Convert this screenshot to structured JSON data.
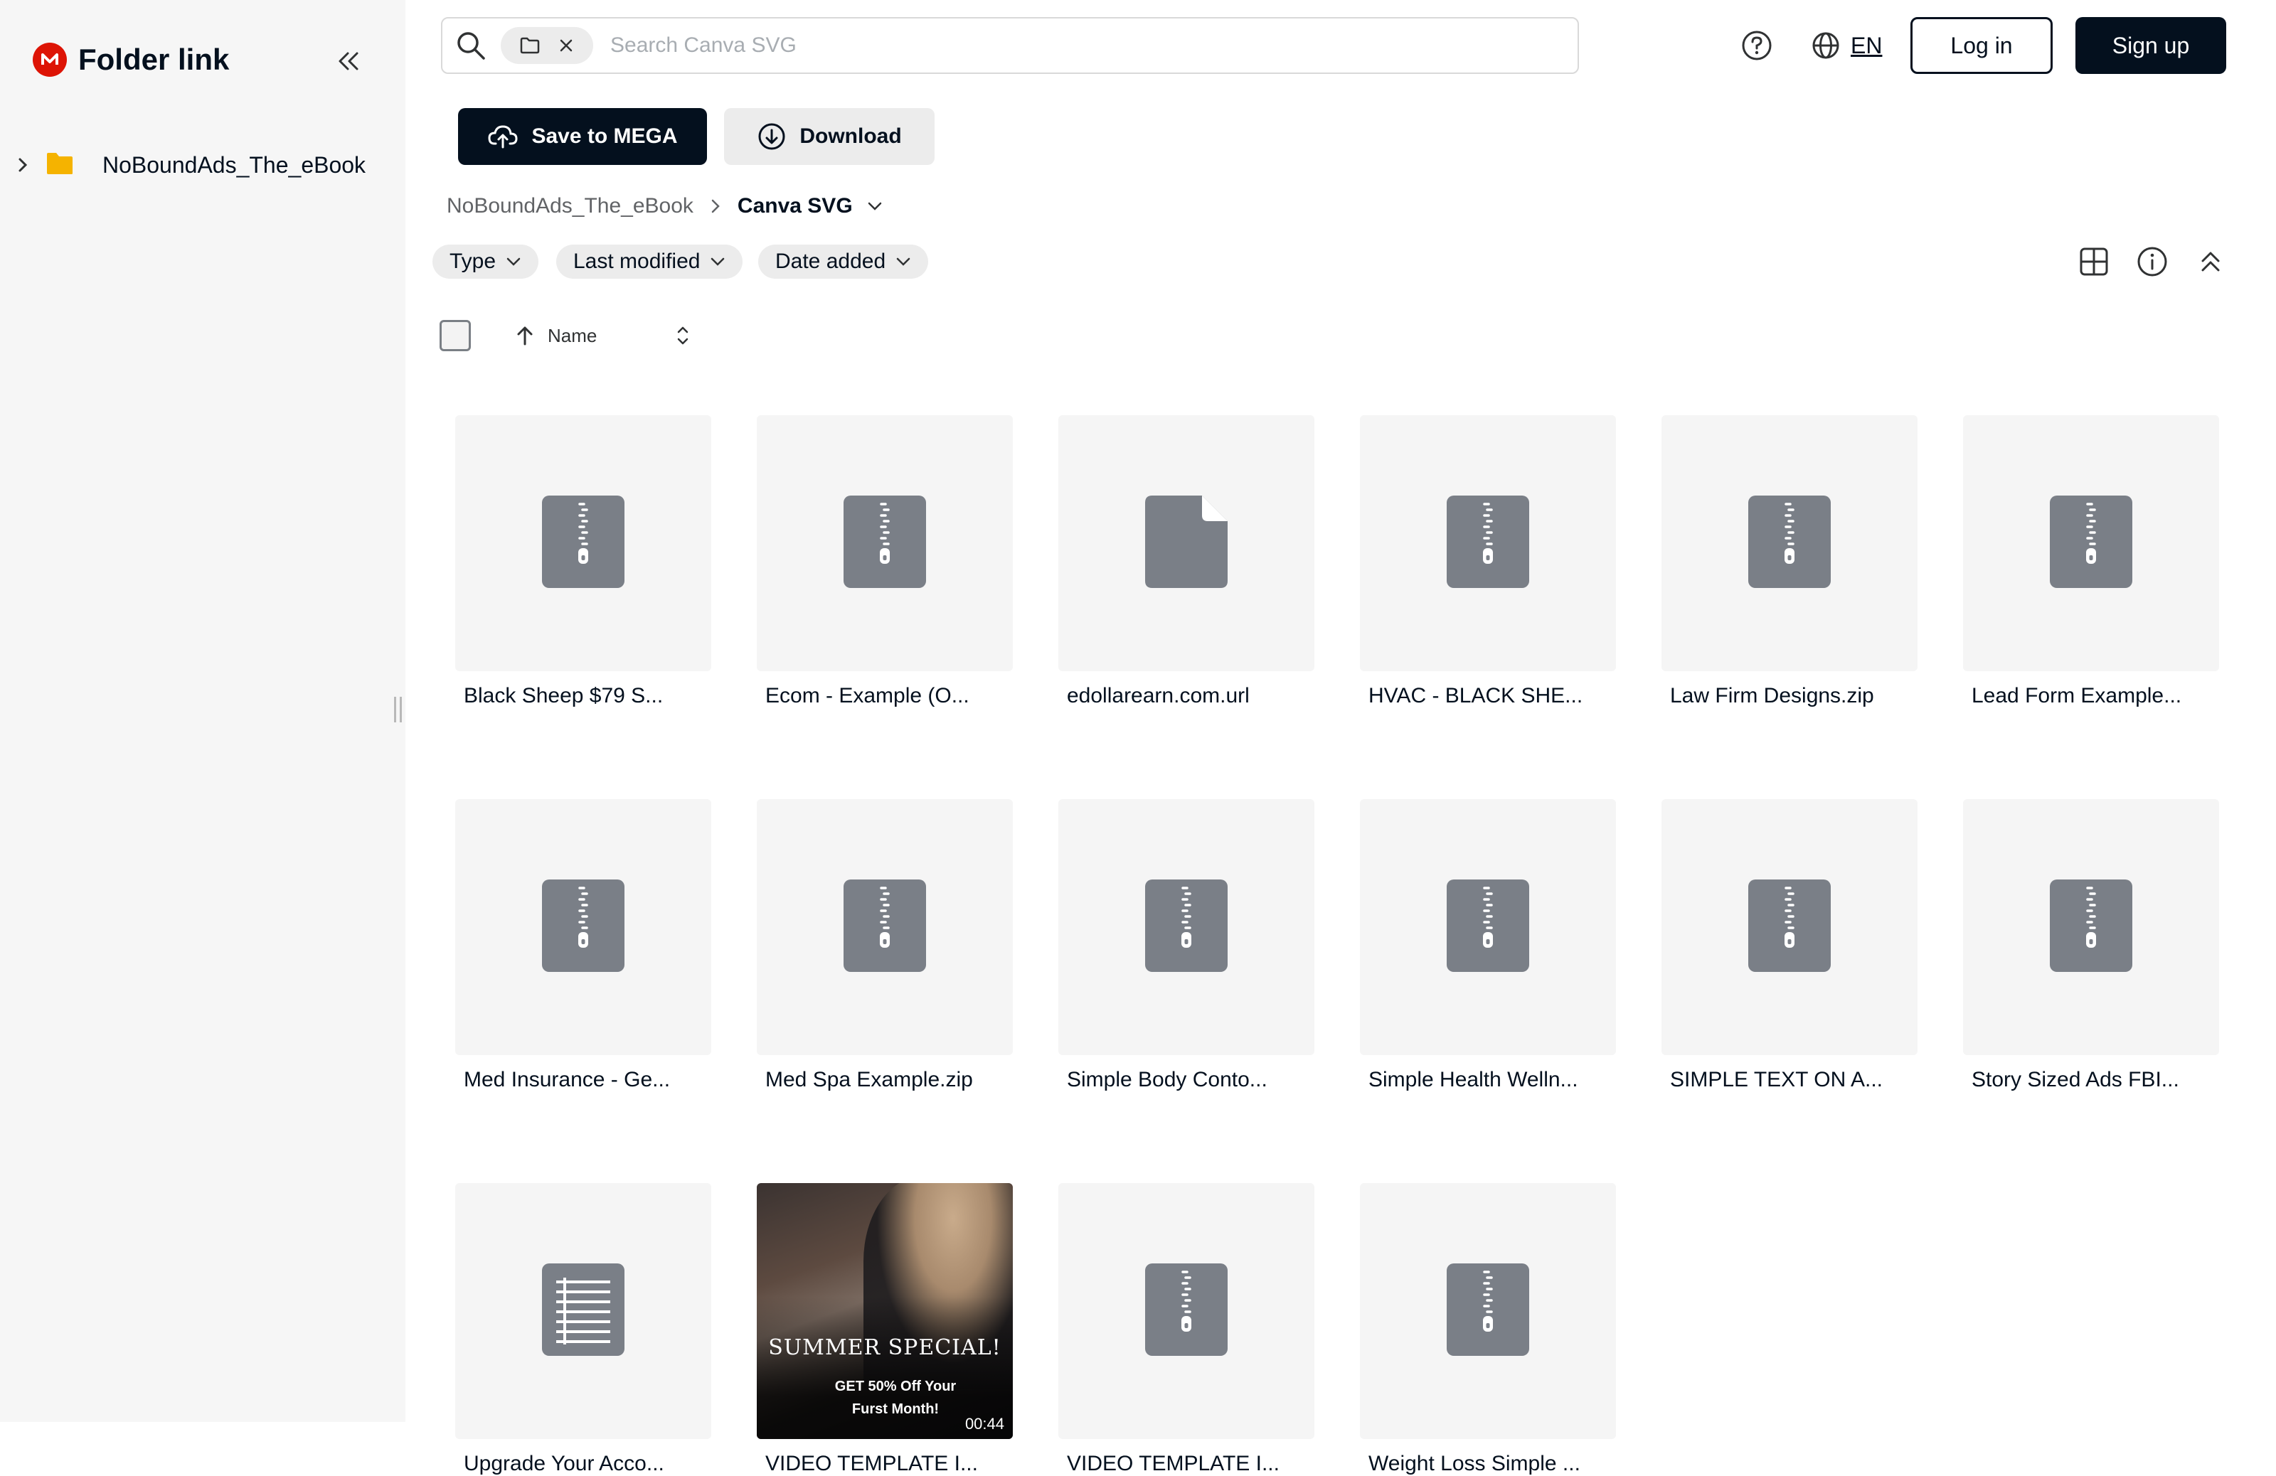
{
  "sidebar": {
    "app_title": "Folder link",
    "tree": [
      {
        "label": "NoBoundAds_The_eBook"
      }
    ]
  },
  "topbar": {
    "search_chip_icon": "folder-icon",
    "search_placeholder": "Search Canva SVG",
    "language": "EN",
    "login_label": "Log in",
    "signup_label": "Sign up"
  },
  "actions": {
    "save_label": "Save to MEGA",
    "download_label": "Download"
  },
  "breadcrumb": {
    "root": "NoBoundAds_The_eBook",
    "current": "Canva SVG"
  },
  "filters": {
    "type": "Type",
    "last_modified": "Last modified",
    "date_added": "Date added"
  },
  "sort": {
    "label": "Name",
    "direction": "ascending"
  },
  "files": [
    {
      "name": "Black Sheep $79 S...",
      "kind": "zip"
    },
    {
      "name": "Ecom - Example (O...",
      "kind": "zip"
    },
    {
      "name": "edollarearn.com.url",
      "kind": "generic"
    },
    {
      "name": "HVAC - BLACK SHE...",
      "kind": "zip"
    },
    {
      "name": "Law Firm Designs.zip",
      "kind": "zip"
    },
    {
      "name": "Lead Form Example...",
      "kind": "zip"
    },
    {
      "name": "Med Insurance - Ge...",
      "kind": "zip"
    },
    {
      "name": "Med Spa Example.zip",
      "kind": "zip"
    },
    {
      "name": "Simple Body Conto...",
      "kind": "zip"
    },
    {
      "name": "Simple Health Welln...",
      "kind": "zip"
    },
    {
      "name": "SIMPLE TEXT ON A...",
      "kind": "zip"
    },
    {
      "name": "Story Sized Ads FBI...",
      "kind": "zip"
    },
    {
      "name": "Upgrade Your Acco...",
      "kind": "text"
    },
    {
      "name": "VIDEO TEMPLATE I...",
      "kind": "video",
      "video_title": "SUMMER SPECIAL!",
      "video_subtitle": "GET 50% Off Your Furst Month!",
      "duration": "00:44"
    },
    {
      "name": "VIDEO TEMPLATE I...",
      "kind": "zip"
    },
    {
      "name": "Weight Loss Simple ...",
      "kind": "zip"
    }
  ],
  "colors": {
    "brand": "#dd1405",
    "primary": "#04101e",
    "folder": "#f5b300",
    "file_icon": "#7a7f87",
    "thumb_bg": "#f5f5f5"
  }
}
